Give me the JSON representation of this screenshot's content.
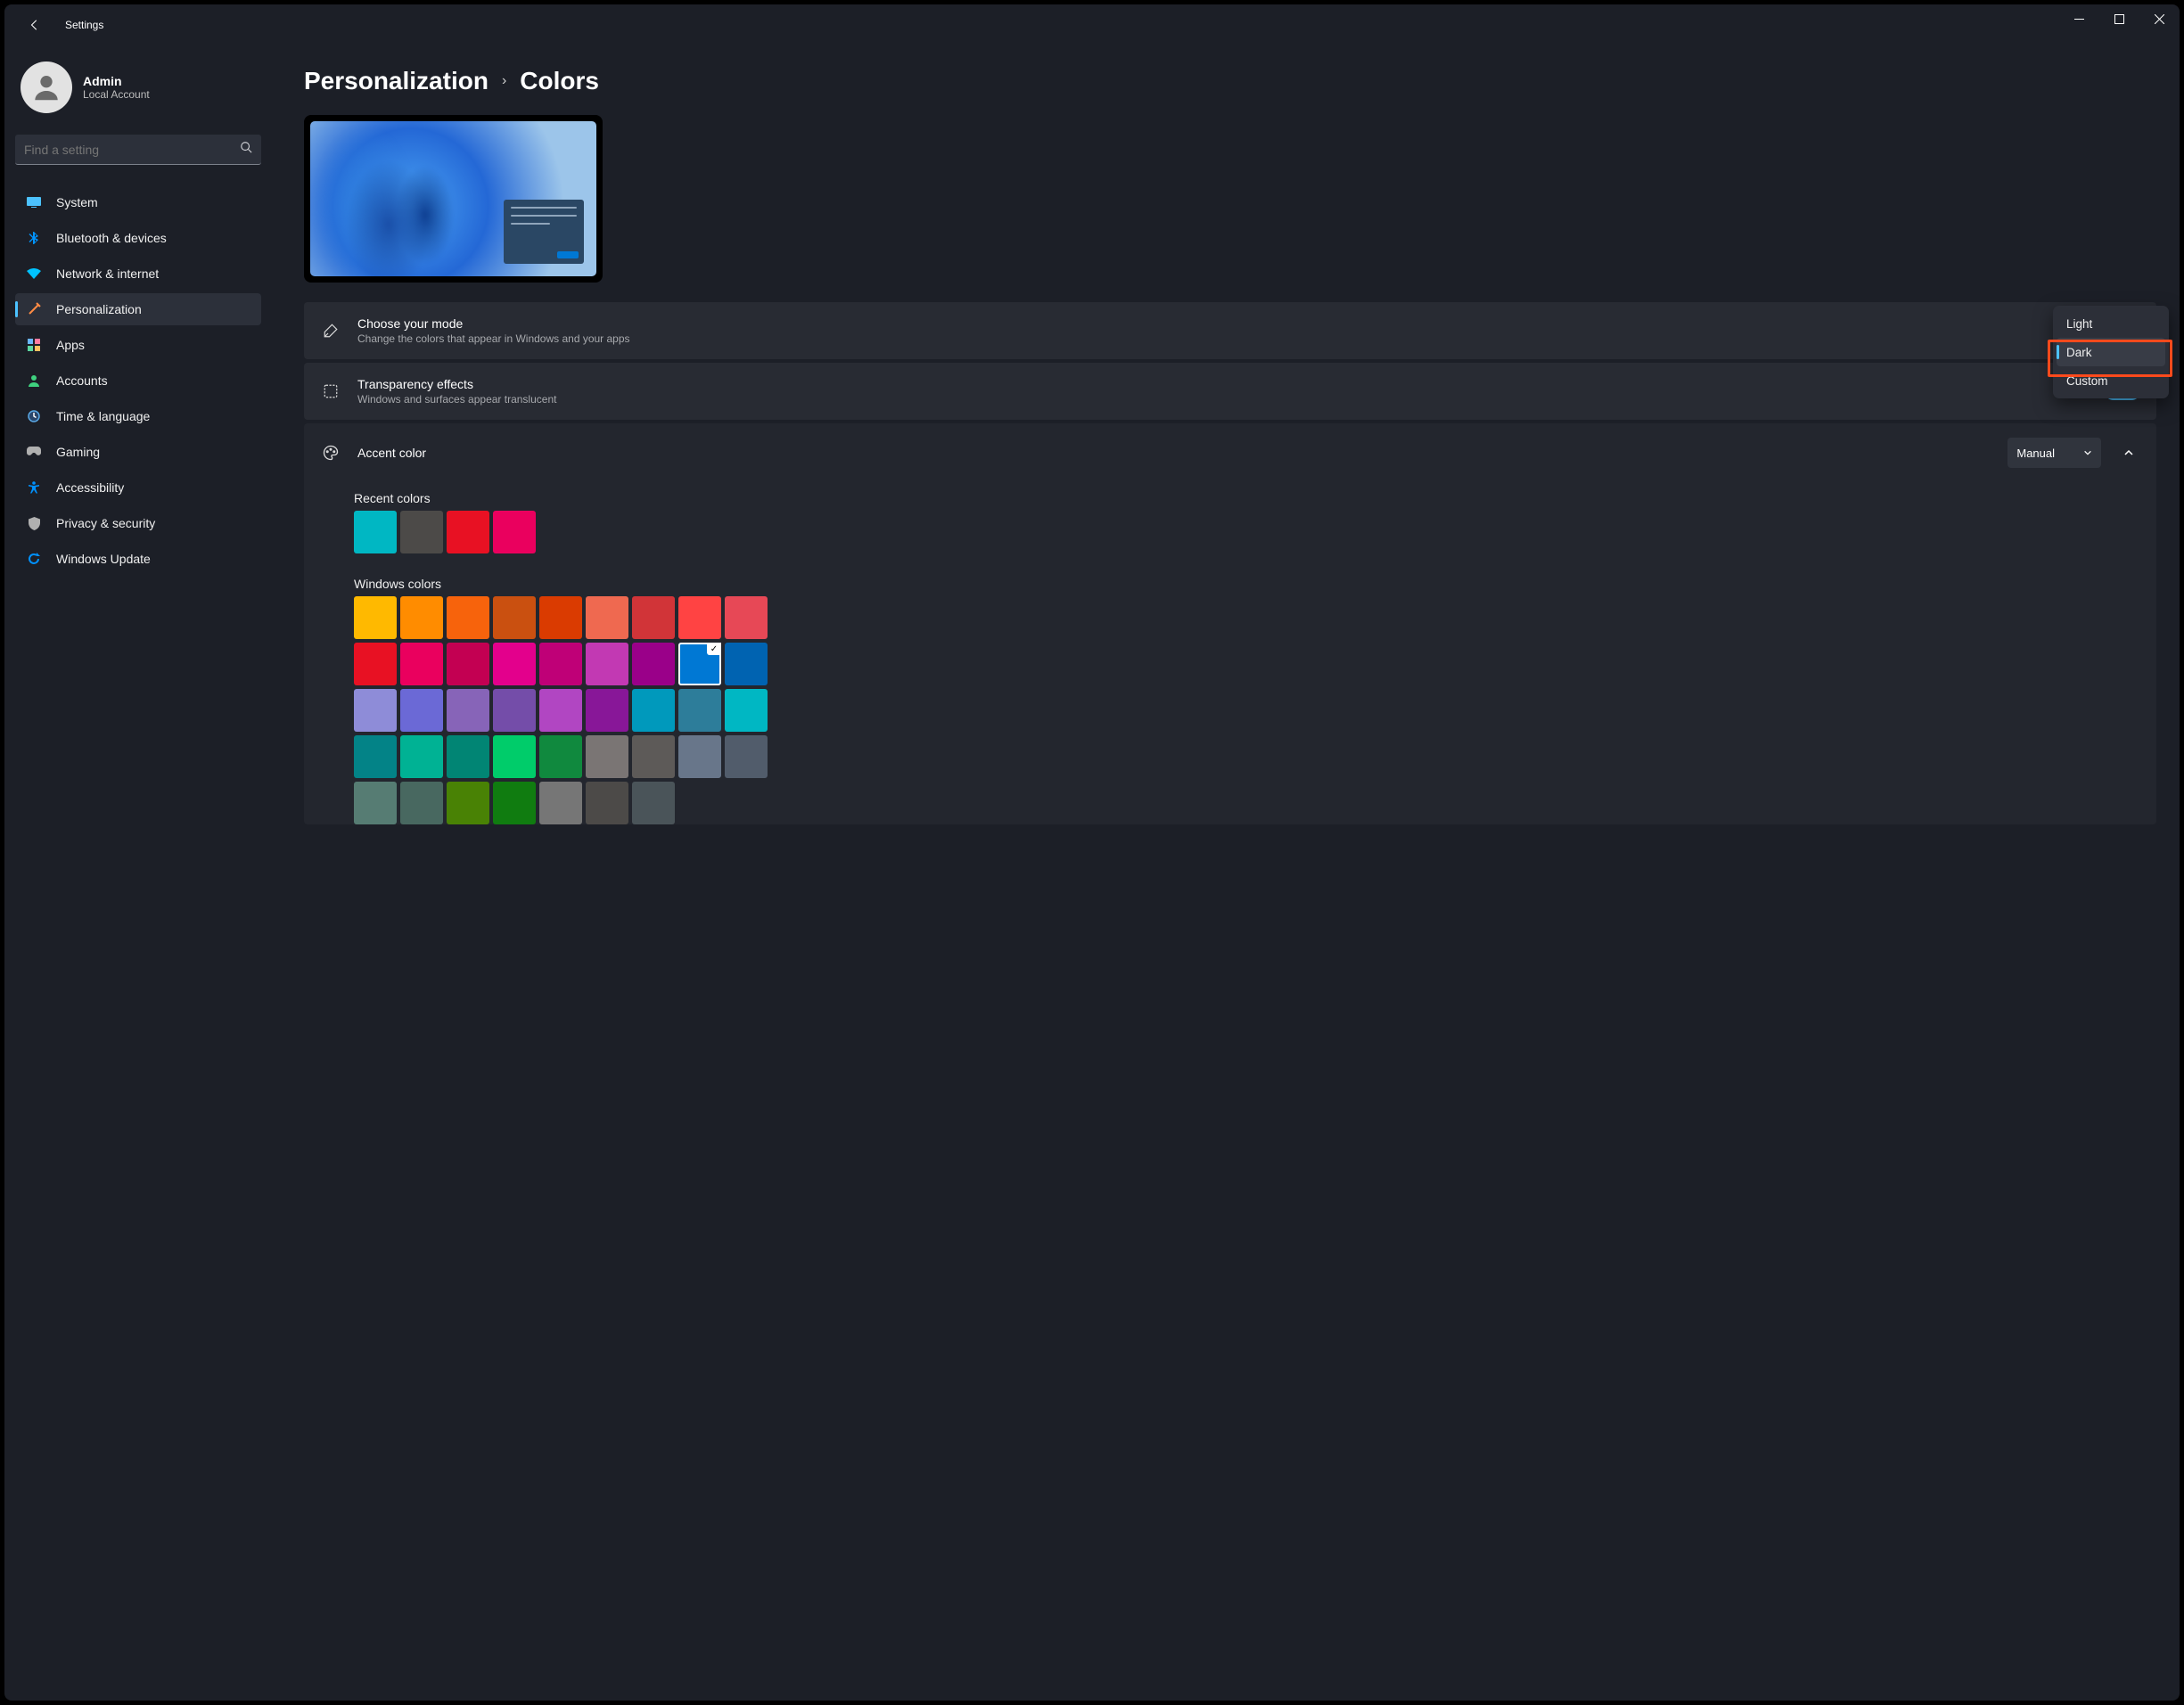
{
  "window": {
    "title": "Settings"
  },
  "account": {
    "name": "Admin",
    "sub": "Local Account"
  },
  "search": {
    "placeholder": "Find a setting"
  },
  "nav": [
    {
      "icon": "system",
      "label": "System",
      "active": false,
      "color": "#4cc2ff"
    },
    {
      "icon": "bluetooth",
      "label": "Bluetooth & devices",
      "active": false,
      "color": "#0094ff"
    },
    {
      "icon": "network",
      "label": "Network & internet",
      "active": false,
      "color": "#00c3ff"
    },
    {
      "icon": "personalization",
      "label": "Personalization",
      "active": true,
      "color": "#ff8c44"
    },
    {
      "icon": "apps",
      "label": "Apps",
      "active": false,
      "color": "#6ab6ff"
    },
    {
      "icon": "accounts",
      "label": "Accounts",
      "active": false,
      "color": "#3fd17f"
    },
    {
      "icon": "time",
      "label": "Time & language",
      "active": false,
      "color": "#5aa9e6"
    },
    {
      "icon": "gaming",
      "label": "Gaming",
      "active": false,
      "color": "#b0b0b0"
    },
    {
      "icon": "accessibility",
      "label": "Accessibility",
      "active": false,
      "color": "#0091ff"
    },
    {
      "icon": "privacy",
      "label": "Privacy & security",
      "active": false,
      "color": "#b0b0b0"
    },
    {
      "icon": "update",
      "label": "Windows Update",
      "active": false,
      "color": "#0091ff"
    }
  ],
  "breadcrumb": {
    "parent": "Personalization",
    "current": "Colors"
  },
  "mode": {
    "title": "Choose your mode",
    "sub": "Change the colors that appear in Windows and your apps",
    "options": [
      "Light",
      "Dark",
      "Custom"
    ],
    "selected": "Dark"
  },
  "transparency": {
    "title": "Transparency effects",
    "sub": "Windows and surfaces appear translucent",
    "state": "On"
  },
  "accent": {
    "title": "Accent color",
    "mode_label": "Manual",
    "recent_label": "Recent colors",
    "recent": [
      "#00b7c3",
      "#4c4a48",
      "#e81123",
      "#ea005e"
    ],
    "win_label": "Windows colors",
    "colors": [
      "#ffb900",
      "#ff8c00",
      "#f7630c",
      "#ca5010",
      "#da3b01",
      "#ef6950",
      "#d13438",
      "#ff4343",
      "#e74856",
      "#e81123",
      "#ea005e",
      "#c30052",
      "#e3008c",
      "#bf0077",
      "#c239b3",
      "#9a0089",
      "#0078d4",
      "#0063b1",
      "#8e8cd8",
      "#6b69d6",
      "#8764b8",
      "#744da9",
      "#b146c2",
      "#881798",
      "#0099bc",
      "#2d7d9a",
      "#00b7c3",
      "#038387",
      "#00b294",
      "#018574",
      "#00cc6a",
      "#10893e",
      "#7a7574",
      "#5d5a58",
      "#68768a",
      "#515c6b",
      "#567c73",
      "#486860",
      "#498205",
      "#107c10",
      "#767676",
      "#4c4a48",
      "#4a5459"
    ],
    "selected_index": 16
  }
}
